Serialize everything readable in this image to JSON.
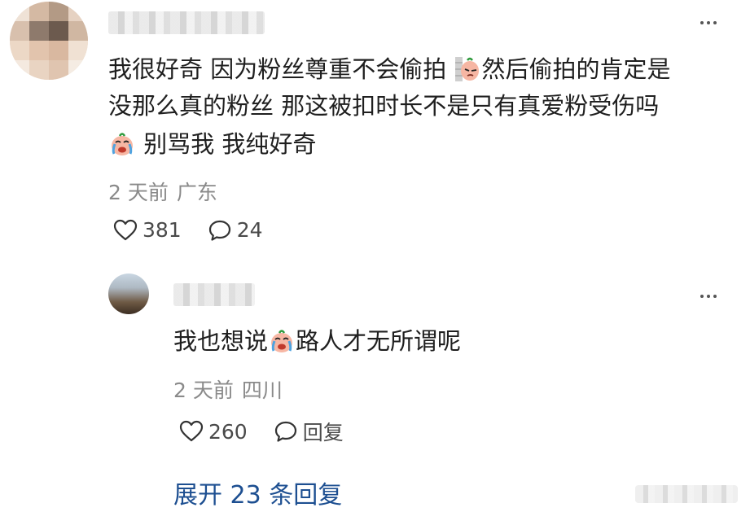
{
  "comment": {
    "line1_a": "我很好奇 因为粉丝尊重不会偷拍",
    "line1_b": "然后偷拍的肯定是",
    "line2": "没那么真的粉丝 那这被扣时长不是只有真爱粉受伤吗",
    "line3": "别骂我 我纯好奇",
    "time": "2 天前",
    "location": "广东",
    "likes": "381",
    "replies": "24"
  },
  "reply": {
    "text_a": "我也想说",
    "text_b": "路人才无所谓呢",
    "time": "2 天前",
    "location": "四川",
    "likes": "260",
    "reply_label": "回复"
  },
  "expand_label": "展开 23 条回复",
  "icons": {
    "more": "more-dots-icon",
    "like": "heart-icon",
    "comment": "speech-bubble-icon",
    "emoji_smirk": "smirk-sticker-icon",
    "emoji_cry": "crying-sticker-icon"
  },
  "colors": {
    "text": "#1f1f1f",
    "meta": "#8a8a8a",
    "link": "#1d4f91"
  }
}
